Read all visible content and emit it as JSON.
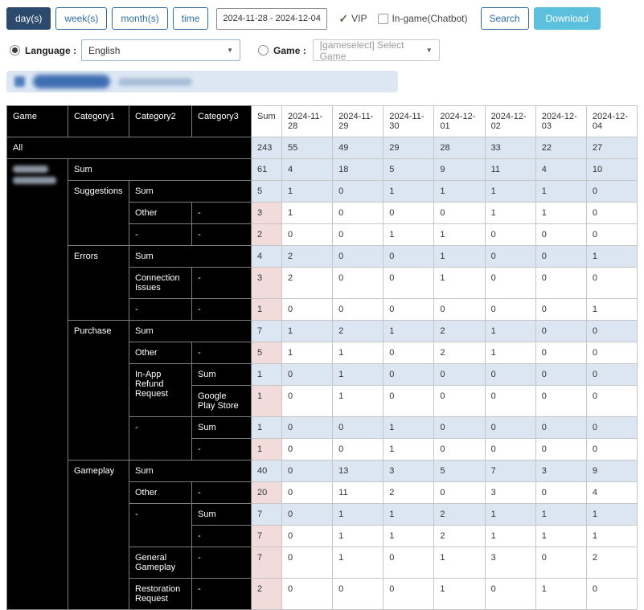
{
  "icons": {
    "check": "✓",
    "caret": "▼"
  },
  "toolbar": {
    "periods": [
      {
        "label": "day(s)",
        "active": true
      },
      {
        "label": "week(s)",
        "active": false
      },
      {
        "label": "month(s)",
        "active": false
      },
      {
        "label": "time",
        "active": false
      }
    ],
    "date_range": "2024-11-28 - 2024-12-04",
    "vip": {
      "label": "VIP",
      "checked": true
    },
    "ingame": {
      "label": "In-game(Chatbot)",
      "checked": false
    },
    "search_label": "Search",
    "download_label": "Download"
  },
  "filters": {
    "language": {
      "label": "Language :",
      "value": "English",
      "selected": true
    },
    "game": {
      "label": "Game :",
      "value": "[gameselect] Select Game",
      "selected": false
    }
  },
  "table": {
    "headers": [
      "Game",
      "Category1",
      "Category2",
      "Category3",
      "Sum",
      "2024-11-28",
      "2024-11-29",
      "2024-11-30",
      "2024-12-01",
      "2024-12-02",
      "2024-12-03",
      "2024-12-04"
    ],
    "all_row": {
      "label": "All",
      "sum": 243,
      "values": [
        55,
        49,
        29,
        28,
        33,
        22,
        27
      ]
    },
    "game_rows": [
      {
        "labels": [
          {
            "text": "Sum",
            "colspan": 3
          }
        ],
        "sum": 61,
        "values": [
          4,
          18,
          5,
          9,
          11,
          4,
          10
        ],
        "highlight": true
      },
      {
        "labels": [
          {
            "text": "Suggestions",
            "rowspan": 3
          },
          {
            "text": "Sum",
            "colspan": 2
          }
        ],
        "sum": 5,
        "values": [
          1,
          0,
          1,
          1,
          1,
          1,
          0
        ],
        "highlight": true
      },
      {
        "labels": [
          {
            "text": "Other"
          },
          {
            "text": "-"
          }
        ],
        "sum": 3,
        "values": [
          1,
          0,
          0,
          0,
          1,
          1,
          0
        ],
        "highlight": false
      },
      {
        "labels": [
          {
            "text": "-"
          },
          {
            "text": "-"
          }
        ],
        "sum": 2,
        "values": [
          0,
          0,
          1,
          1,
          0,
          0,
          0
        ],
        "highlight": false
      },
      {
        "labels": [
          {
            "text": "Errors",
            "rowspan": 3
          },
          {
            "text": "Sum",
            "colspan": 2
          }
        ],
        "sum": 4,
        "values": [
          2,
          0,
          0,
          1,
          0,
          0,
          1
        ],
        "highlight": true
      },
      {
        "labels": [
          {
            "text": "Connection Issues"
          },
          {
            "text": "-"
          }
        ],
        "sum": 3,
        "values": [
          2,
          0,
          0,
          1,
          0,
          0,
          0
        ],
        "highlight": false
      },
      {
        "labels": [
          {
            "text": "-"
          },
          {
            "text": "-"
          }
        ],
        "sum": 1,
        "values": [
          0,
          0,
          0,
          0,
          0,
          0,
          1
        ],
        "highlight": false
      },
      {
        "labels": [
          {
            "text": "Purchase",
            "rowspan": 6
          },
          {
            "text": "Sum",
            "colspan": 2
          }
        ],
        "sum": 7,
        "values": [
          1,
          2,
          1,
          2,
          1,
          0,
          0
        ],
        "highlight": true
      },
      {
        "labels": [
          {
            "text": "Other"
          },
          {
            "text": "-"
          }
        ],
        "sum": 5,
        "values": [
          1,
          1,
          0,
          2,
          1,
          0,
          0
        ],
        "highlight": false
      },
      {
        "labels": [
          {
            "text": "In-App Refund Request",
            "rowspan": 2
          },
          {
            "text": "Sum"
          }
        ],
        "sum": 1,
        "values": [
          0,
          1,
          0,
          0,
          0,
          0,
          0
        ],
        "highlight": true
      },
      {
        "labels": [
          {
            "text": "Google Play Store"
          }
        ],
        "sum": 1,
        "values": [
          0,
          1,
          0,
          0,
          0,
          0,
          0
        ],
        "highlight": false
      },
      {
        "labels": [
          {
            "text": "-",
            "rowspan": 2
          },
          {
            "text": "Sum"
          }
        ],
        "sum": 1,
        "values": [
          0,
          0,
          1,
          0,
          0,
          0,
          0
        ],
        "highlight": true
      },
      {
        "labels": [
          {
            "text": "-"
          }
        ],
        "sum": 1,
        "values": [
          0,
          0,
          1,
          0,
          0,
          0,
          0
        ],
        "highlight": false
      },
      {
        "labels": [
          {
            "text": "Gameplay",
            "rowspan": 6
          },
          {
            "text": "Sum",
            "colspan": 2
          }
        ],
        "sum": 40,
        "values": [
          0,
          13,
          3,
          5,
          7,
          3,
          9
        ],
        "highlight": true
      },
      {
        "labels": [
          {
            "text": "Other"
          },
          {
            "text": "-"
          }
        ],
        "sum": 20,
        "values": [
          0,
          11,
          2,
          0,
          3,
          0,
          4
        ],
        "highlight": false
      },
      {
        "labels": [
          {
            "text": "-",
            "rowspan": 2
          },
          {
            "text": "Sum"
          }
        ],
        "sum": 7,
        "values": [
          0,
          1,
          1,
          2,
          1,
          1,
          1
        ],
        "highlight": true
      },
      {
        "labels": [
          {
            "text": "-"
          }
        ],
        "sum": 7,
        "values": [
          0,
          1,
          1,
          2,
          1,
          1,
          1
        ],
        "highlight": false
      },
      {
        "labels": [
          {
            "text": "General Gameplay"
          },
          {
            "text": "-"
          }
        ],
        "sum": 7,
        "values": [
          0,
          1,
          0,
          1,
          3,
          0,
          2
        ],
        "highlight": false
      },
      {
        "labels": [
          {
            "text": "Restoration Request"
          },
          {
            "text": "-"
          }
        ],
        "sum": 2,
        "values": [
          0,
          0,
          0,
          1,
          0,
          1,
          0
        ],
        "highlight": false
      }
    ]
  }
}
